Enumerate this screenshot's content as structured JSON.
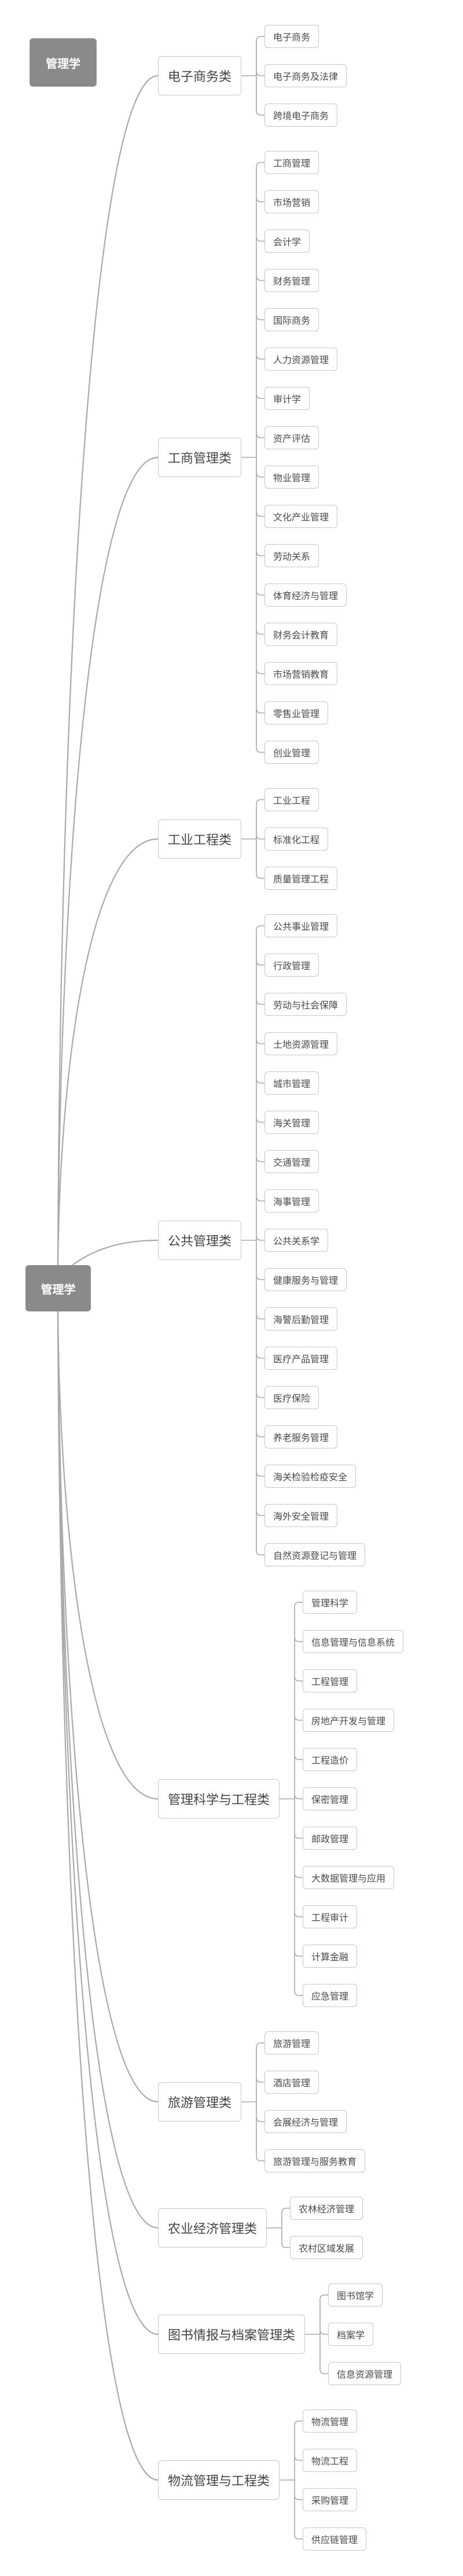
{
  "title_badge": "管理学",
  "root": {
    "label": "管理学"
  },
  "colors": {
    "node_fill": "#8a8a8a",
    "line": "#aaaaaa",
    "border": "#c8c8c8",
    "text": "#444444"
  },
  "branches": [
    {
      "label": "电子商务类",
      "children": [
        "电子商务",
        "电子商务及法律",
        "跨境电子商务"
      ]
    },
    {
      "label": "工商管理类",
      "children": [
        "工商管理",
        "市场营销",
        "会计学",
        "财务管理",
        "国际商务",
        "人力资源管理",
        "审计学",
        "资产评估",
        "物业管理",
        "文化产业管理",
        "劳动关系",
        "体育经济与管理",
        "财务会计教育",
        "市场营销教育",
        "零售业管理",
        "创业管理"
      ]
    },
    {
      "label": "工业工程类",
      "children": [
        "工业工程",
        "标准化工程",
        "质量管理工程"
      ]
    },
    {
      "label": "公共管理类",
      "children": [
        "公共事业管理",
        "行政管理",
        "劳动与社会保障",
        "土地资源管理",
        "城市管理",
        "海关管理",
        "交通管理",
        "海事管理",
        "公共关系学",
        "健康服务与管理",
        "海警后勤管理",
        "医疗产品管理",
        "医疗保险",
        "养老服务管理",
        "海关检验检疫安全",
        "海外安全管理",
        "自然资源登记与管理"
      ]
    },
    {
      "label": "管理科学与工程类",
      "children": [
        "管理科学",
        "信息管理与信息系统",
        "工程管理",
        "房地产开发与管理",
        "工程造价",
        "保密管理",
        "邮政管理",
        "大数据管理与应用",
        "工程审计",
        "计算金融",
        "应急管理"
      ]
    },
    {
      "label": "旅游管理类",
      "children": [
        "旅游管理",
        "酒店管理",
        "会展经济与管理",
        "旅游管理与服务教育"
      ]
    },
    {
      "label": "农业经济管理类",
      "children": [
        "农林经济管理",
        "农村区域发展"
      ]
    },
    {
      "label": "图书情报与档案管理类",
      "children": [
        "图书馆学",
        "档案学",
        "信息资源管理"
      ]
    },
    {
      "label": "物流管理与工程类",
      "children": [
        "物流管理",
        "物流工程",
        "采购管理",
        "供应链管理"
      ]
    }
  ]
}
